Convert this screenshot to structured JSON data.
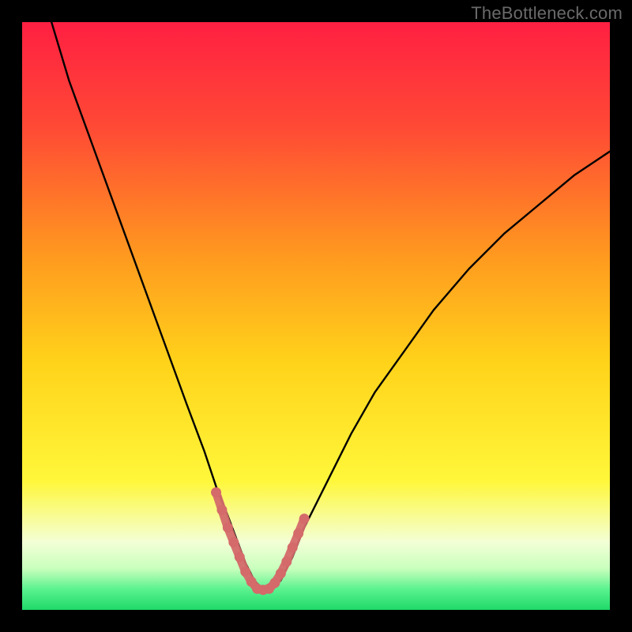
{
  "watermark": "TheBottleneck.com",
  "colors": {
    "background": "#000000",
    "gradient_top": "#ff1f42",
    "gradient_mid_upper": "#ff7a2a",
    "gradient_mid": "#ffd31a",
    "gradient_mid_lower": "#f8ff3a",
    "gradient_band": "#f3ffd6",
    "gradient_green": "#24e06e",
    "curve_stroke": "#000000",
    "marker_stroke": "#d46a6a",
    "marker_fill": "#d46a6a"
  },
  "chart_data": {
    "type": "line",
    "title": "",
    "xlabel": "",
    "ylabel": "",
    "xlim": [
      0,
      100
    ],
    "ylim": [
      0,
      100
    ],
    "series": [
      {
        "name": "bottleneck-curve",
        "x": [
          5,
          8,
          12,
          16,
          20,
          24,
          28,
          31,
          33,
          35,
          36.5,
          38,
          39.5,
          41,
          42.5,
          44,
          46,
          48,
          52,
          56,
          60,
          65,
          70,
          76,
          82,
          88,
          94,
          100
        ],
        "y": [
          100,
          90,
          79,
          68,
          57,
          46,
          35,
          27,
          21,
          16,
          12,
          8,
          5,
          3.5,
          3.5,
          5,
          9,
          14,
          22,
          30,
          37,
          44,
          51,
          58,
          64,
          69,
          74,
          78
        ]
      }
    ],
    "highlight": {
      "name": "optimal-range",
      "x": [
        33,
        34,
        35,
        36,
        37,
        38,
        39,
        40,
        41,
        42,
        43,
        44,
        45,
        46,
        47,
        48
      ],
      "y": [
        20,
        17,
        14,
        11.5,
        9,
        6.5,
        4.8,
        3.6,
        3.4,
        3.6,
        4.6,
        6.2,
        8.2,
        10.6,
        13,
        15.5
      ]
    }
  }
}
